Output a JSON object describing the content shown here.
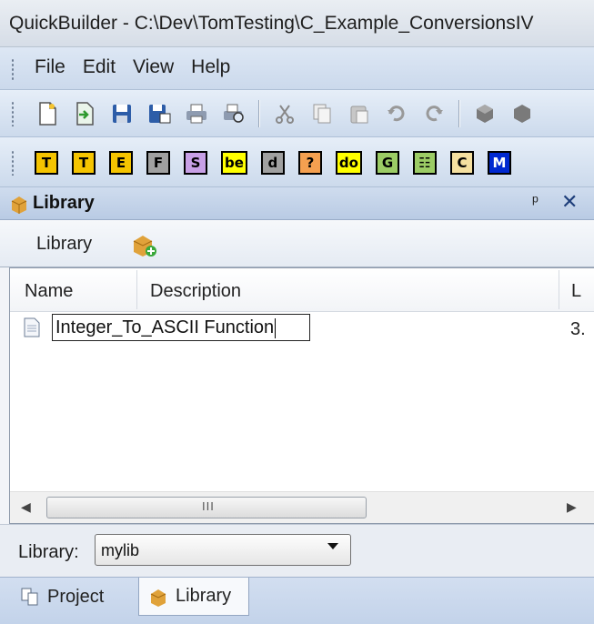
{
  "window": {
    "title": "QuickBuilder - C:\\Dev\\TomTesting\\C_Example_ConversionsIV"
  },
  "menu": {
    "items": [
      "File",
      "Edit",
      "View",
      "Help"
    ]
  },
  "toolbar": {
    "icons": [
      "new-file-icon",
      "import-icon",
      "save-icon",
      "save-as-icon",
      "print-icon",
      "print-preview-icon",
      "cut-icon",
      "copy-icon",
      "paste-icon",
      "undo-icon",
      "redo-icon",
      "cube-icon",
      "cube-icon-2"
    ]
  },
  "block_toolbar": {
    "buttons": [
      {
        "label": "T",
        "bg": "#f5c400",
        "fg": "#000"
      },
      {
        "label": "T",
        "bg": "#f5c400",
        "fg": "#000"
      },
      {
        "label": "E",
        "bg": "#f5c400",
        "fg": "#000"
      },
      {
        "label": "F",
        "bg": "#a0a0a0",
        "fg": "#000"
      },
      {
        "label": "S",
        "bg": "#c8a0e6",
        "fg": "#000"
      },
      {
        "label": "be",
        "bg": "#ffff00",
        "fg": "#000"
      },
      {
        "label": "d",
        "bg": "#a0a0a0",
        "fg": "#000"
      },
      {
        "label": "?",
        "bg": "#f5a050",
        "fg": "#000"
      },
      {
        "label": "do",
        "bg": "#ffff00",
        "fg": "#000"
      },
      {
        "label": "G",
        "bg": "#9ccc65",
        "fg": "#000"
      },
      {
        "label": "☷",
        "bg": "#9ccc65",
        "fg": "#000"
      },
      {
        "label": "C",
        "bg": "#f5e0a0",
        "fg": "#000"
      },
      {
        "label": "M",
        "bg": "#0028d0",
        "fg": "#fff"
      }
    ]
  },
  "library_panel": {
    "title": "Library",
    "pin_glyph": "ᵖ",
    "close_glyph": "✕",
    "toolbar_label": "Library",
    "columns": [
      "Name",
      "Description",
      "L"
    ],
    "rows": [
      {
        "name_edit_value": "Integer_To_ASCII Function",
        "col3": "3."
      }
    ],
    "scroll_grip": "III",
    "library_select_label": "Library:",
    "library_select_value": "mylib"
  },
  "bottom_tabs": [
    {
      "label": "Project",
      "selected": false
    },
    {
      "label": "Library",
      "selected": true
    }
  ]
}
